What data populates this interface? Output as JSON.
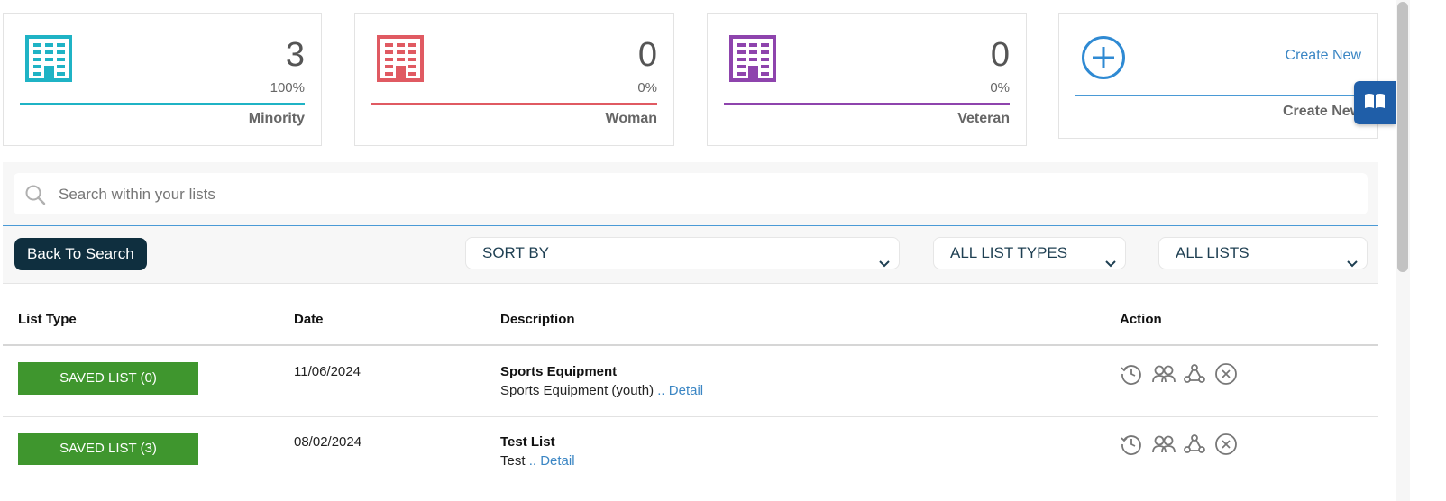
{
  "cards": [
    {
      "count": "3",
      "pct": "100%",
      "label": "Minority",
      "color": "#1fb3c5"
    },
    {
      "count": "0",
      "pct": "0%",
      "label": "Woman",
      "color": "#e05a62"
    },
    {
      "count": "0",
      "pct": "0%",
      "label": "Veteran",
      "color": "#8e44ad"
    }
  ],
  "create_card": {
    "link": "Create New",
    "label": "Create New",
    "color": "#2f8ad3"
  },
  "search": {
    "placeholder": "Search within your lists"
  },
  "toolbar": {
    "back_label": "Back To Search",
    "sort_label": "SORT BY",
    "types_label": "ALL LIST TYPES",
    "lists_label": "ALL LISTS"
  },
  "table": {
    "headers": [
      "List Type",
      "Date",
      "Description",
      "Action"
    ],
    "rows": [
      {
        "badge": "SAVED LIST (0)",
        "date": "11/06/2024",
        "title": "Sports Equipment",
        "desc": "Sports Equipment (youth)",
        "detail": ".. Detail"
      },
      {
        "badge": "SAVED LIST (3)",
        "date": "08/02/2024",
        "title": "Test List",
        "desc": "Test",
        "detail": ".. Detail"
      }
    ]
  },
  "colors": {
    "badge": "#3f962e",
    "button": "#0f2f3f",
    "link": "#3b86c4",
    "accent": "#1f5ea8"
  }
}
